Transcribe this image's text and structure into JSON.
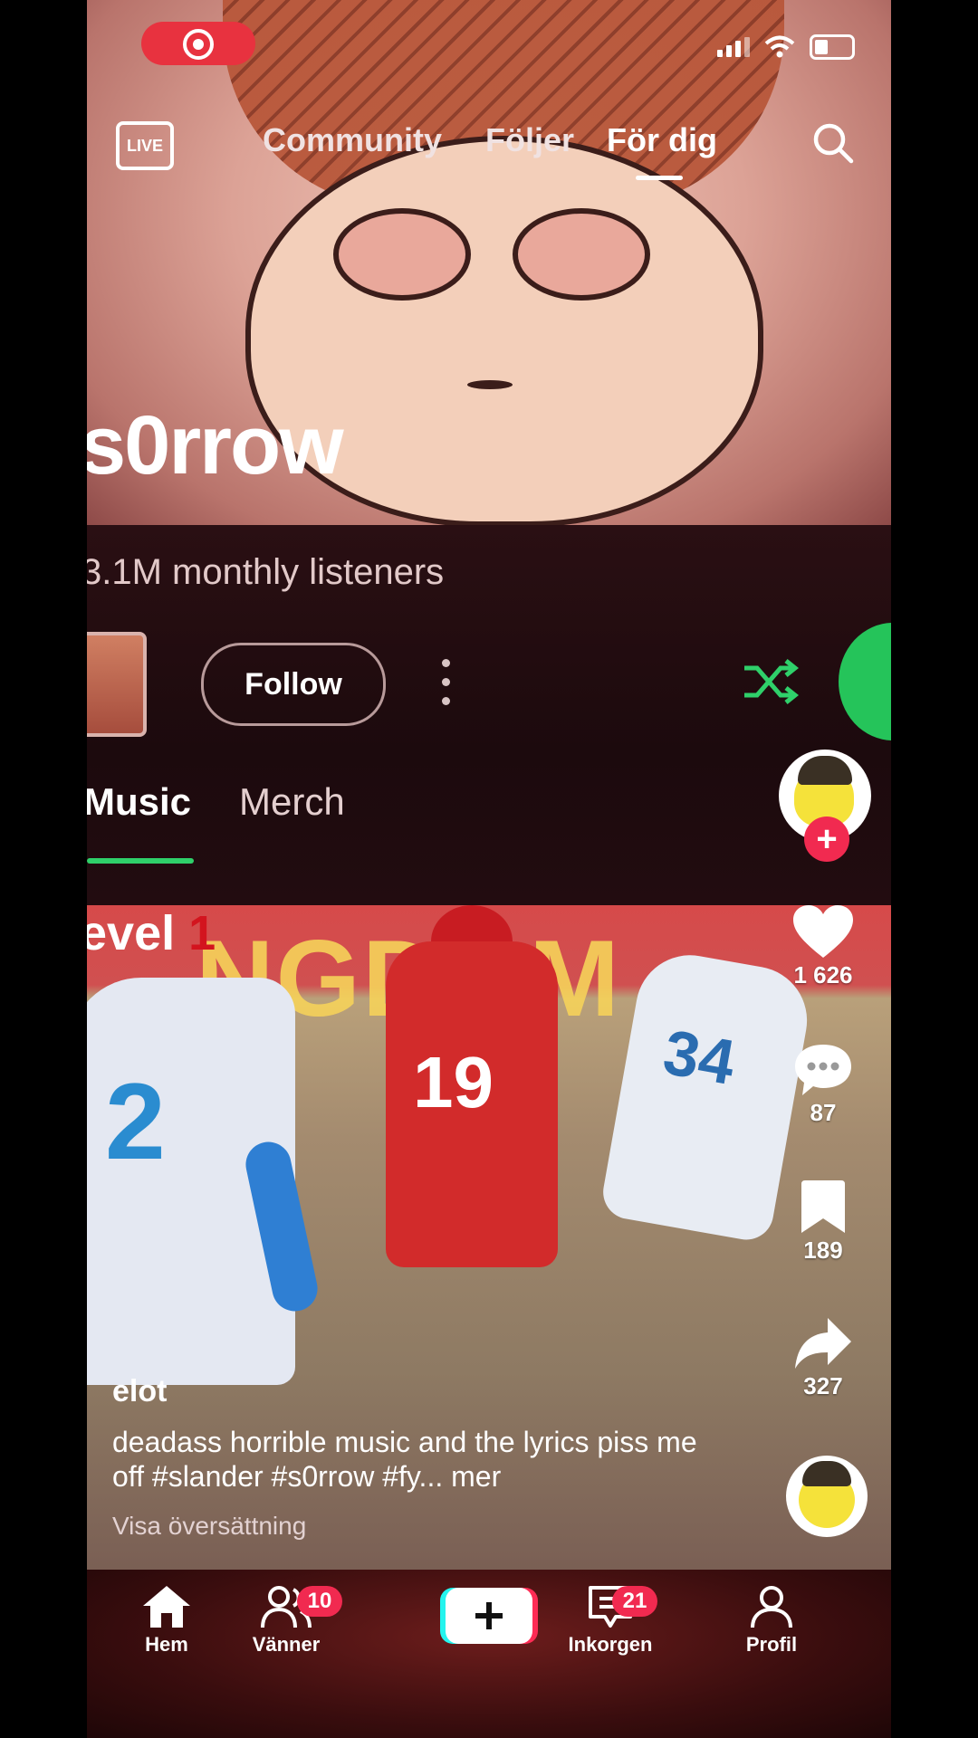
{
  "status_bar": {
    "recording": true
  },
  "top_nav": {
    "live_label": "LIVE",
    "tabs": [
      {
        "label": "Community",
        "active": false
      },
      {
        "label": "Följer",
        "active": false
      },
      {
        "label": "För dig",
        "active": true
      }
    ]
  },
  "video_content": {
    "artist_name": "s0rrow",
    "listeners": "3.1M monthly listeners",
    "follow_label": "Follow",
    "tabs": [
      "Music",
      "Merch"
    ],
    "level_text": "evel",
    "level_number": "1",
    "stadium_text": "NGDOM",
    "jersey_red": "19",
    "jersey_white_left": "2",
    "jersey_white_right": "34"
  },
  "rail": {
    "likes": "1 626",
    "comments": "87",
    "saves": "189",
    "shares": "327"
  },
  "caption": {
    "username": "elot",
    "text": "deadass horrible music and the lyrics piss me off #slander #s0rrow #fy... mer",
    "translate": "Visa översättning"
  },
  "bottom_nav": {
    "items": [
      {
        "label": "Hem"
      },
      {
        "label": "Vänner",
        "badge": "10"
      },
      {
        "label": "Inkorgen",
        "badge": "21"
      },
      {
        "label": "Profil"
      }
    ]
  },
  "colors": {
    "accent": "#f12a50",
    "spotify_green": "#25c45a"
  }
}
